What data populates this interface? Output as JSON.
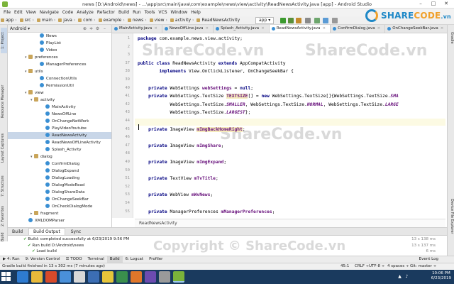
{
  "window": {
    "title": "news [D:\\Android\\news] - ...\\app\\src\\main\\java\\com\\example\\news\\view\\activity\\ReadNewsActivity.java [app] - Android Studio",
    "minimize": "–",
    "maximize": "□",
    "close": "✕"
  },
  "menu": [
    "File",
    "Edit",
    "View",
    "Navigate",
    "Code",
    "Analyze",
    "Refactor",
    "Build",
    "Run",
    "Tools",
    "VCS",
    "Window",
    "Help"
  ],
  "breadcrumb": [
    "app",
    "src",
    "main",
    "java",
    "com",
    "example",
    "news",
    "view",
    "activity",
    "ReadNewsActivity"
  ],
  "run_config": "app ▾",
  "logo": {
    "prefix": "SHARE",
    "suffix": "CODE",
    "domain": ".vn"
  },
  "watermark": "ShareCode.vn",
  "watermark_bottom": "Copyright © ShareCode.vn",
  "left_tabs": [
    "1: Project",
    "Resource Manager",
    "Layout Captures",
    "7: Structure",
    "2: Favorites",
    "Build Variants"
  ],
  "right_tabs": [
    "Gradle",
    "Device File Explorer"
  ],
  "project": {
    "selector": "Android ▾",
    "header_icons": [
      "⊕",
      "≑",
      "⚙",
      "–"
    ],
    "tree": [
      {
        "label": "News",
        "type": "cls",
        "depth": 5,
        "arrow": ""
      },
      {
        "label": "PlayList",
        "type": "cls",
        "depth": 5,
        "arrow": ""
      },
      {
        "label": "Video",
        "type": "cls",
        "depth": 5,
        "arrow": ""
      },
      {
        "label": "preferences",
        "type": "pkg",
        "depth": 3,
        "arrow": "▾"
      },
      {
        "label": "ManagerPreferences",
        "type": "cls",
        "depth": 5,
        "arrow": ""
      },
      {
        "label": "utils",
        "type": "pkg",
        "depth": 3,
        "arrow": "▾"
      },
      {
        "label": "ConnectionUtils",
        "type": "cls",
        "depth": 5,
        "arrow": ""
      },
      {
        "label": "PermissionUtil",
        "type": "cls",
        "depth": 5,
        "arrow": ""
      },
      {
        "label": "view",
        "type": "pkg",
        "depth": 3,
        "arrow": "▾"
      },
      {
        "label": "activity",
        "type": "pkg",
        "depth": 4,
        "arrow": "▾"
      },
      {
        "label": "MainActivity",
        "type": "cls",
        "depth": 6,
        "arrow": ""
      },
      {
        "label": "NewsOffLine",
        "type": "cls",
        "depth": 6,
        "arrow": ""
      },
      {
        "label": "OnChangeNetWork",
        "type": "cls",
        "depth": 6,
        "arrow": ""
      },
      {
        "label": "PlayVideoYoutube",
        "type": "cls",
        "depth": 6,
        "arrow": ""
      },
      {
        "label": "ReadNewsActivity",
        "type": "cls",
        "depth": 6,
        "arrow": "",
        "selected": true
      },
      {
        "label": "ReadNewsOffLineActivity",
        "type": "cls",
        "depth": 6,
        "arrow": ""
      },
      {
        "label": "Splash_Activity",
        "type": "cls",
        "depth": 6,
        "arrow": ""
      },
      {
        "label": "dialog",
        "type": "pkg",
        "depth": 4,
        "arrow": "▾"
      },
      {
        "label": "ConfirmDialog",
        "type": "cls",
        "depth": 6,
        "arrow": ""
      },
      {
        "label": "DialogExpand",
        "type": "cls",
        "depth": 6,
        "arrow": ""
      },
      {
        "label": "DialogLoading",
        "type": "cls",
        "depth": 6,
        "arrow": ""
      },
      {
        "label": "DialogModeRead",
        "type": "cls",
        "depth": 6,
        "arrow": ""
      },
      {
        "label": "DialogShareData",
        "type": "cls",
        "depth": 6,
        "arrow": ""
      },
      {
        "label": "OnChangeSeekBar",
        "type": "cls",
        "depth": 6,
        "arrow": ""
      },
      {
        "label": "OnCheckDialogMode",
        "type": "cls",
        "depth": 6,
        "arrow": ""
      },
      {
        "label": "fragment",
        "type": "pkg",
        "depth": 4,
        "arrow": "▸"
      },
      {
        "label": "XMLDOMParser",
        "type": "cls",
        "depth": 3,
        "arrow": ""
      }
    ]
  },
  "editor_tabs": [
    {
      "label": "MainActivity.java",
      "active": false
    },
    {
      "label": "NewsOffLine.java",
      "active": false
    },
    {
      "label": "Splash_Activity.java",
      "active": false
    },
    {
      "label": "ReadNewsActivity.java",
      "active": true
    },
    {
      "label": "ConfirmDialog.java",
      "active": false
    },
    {
      "label": "OnChangeSeekBar.java",
      "active": false
    }
  ],
  "code": [
    {
      "ln": "1",
      "html": "<span class=\"kw\">package</span> com.example.news.view.activity;"
    },
    {
      "ln": "2",
      "html": ""
    },
    {
      "ln": "3",
      "html": ""
    },
    {
      "ln": "37",
      "html": "<span class=\"kw\">public class</span> ReadNewsActivity <span class=\"kw\">extends</span> AppCompatActivity"
    },
    {
      "ln": "38",
      "html": "        <span class=\"kw\">implements</span> View.OnClickListener, OnChangeSeekBar {"
    },
    {
      "ln": "39",
      "html": ""
    },
    {
      "ln": "40",
      "html": "    <span class=\"kw\">private</span> WebSettings <span class=\"fld\">webSettings</span> = <span class=\"kw\">null</span>;"
    },
    {
      "ln": "41",
      "html": "    <span class=\"kw\">private</span> WebSettings.TextSize <span class=\"fld warnbg\">TEXTSIZE</span>[] = <span class=\"kw\">new</span> WebSettings.TextSize[]{WebSettings.TextSize.<span class=\"it\">SMA</span>"
    },
    {
      "ln": "42",
      "html": "            WebSettings.TextSize.<span class=\"it\">SMALLER</span>, WebSettings.TextSize.<span class=\"it\">NORMAL</span>, WebSettings.TextSize.<span class=\"it\">LARGE</span>"
    },
    {
      "ln": "43",
      "html": "            WebSettings.TextSize.<span class=\"it\">LARGEST</span>};"
    },
    {
      "ln": "44",
      "html": "",
      "hl": true
    },
    {
      "ln": "45",
      "html": "    <span class=\"kw\">private</span> ImageView <span class=\"fld warnbg\">mImgBackHomeRight</span>;"
    },
    {
      "ln": "46",
      "html": ""
    },
    {
      "ln": "47",
      "html": "    <span class=\"kw\">private</span> ImageView <span class=\"fld\">mImgShare</span>;"
    },
    {
      "ln": "48",
      "html": ""
    },
    {
      "ln": "49",
      "html": "    <span class=\"kw\">private</span> ImageView <span class=\"fld\">mImgExpand</span>;"
    },
    {
      "ln": "50",
      "html": ""
    },
    {
      "ln": "51",
      "html": "    <span class=\"kw\">private</span> TextView <span class=\"fld\">mTvTitle</span>;"
    },
    {
      "ln": "52",
      "html": ""
    },
    {
      "ln": "53",
      "html": "    <span class=\"kw\">private</span> WebView <span class=\"fld\">mWvNews</span>;"
    },
    {
      "ln": "54",
      "html": ""
    },
    {
      "ln": "55",
      "html": "    <span class=\"kw\">private</span> ManagerPreferences <span class=\"fld\">mManagerPreferences</span>;"
    }
  ],
  "editor_breadcrumb": "ReadNewsActivity",
  "build": {
    "tabs": [
      "Build",
      "Build Output",
      "Sync"
    ],
    "rows": [
      {
        "text": "Build: completed successfully at 6/23/2019 9:56 PM",
        "time": "13 s 138 ms",
        "indent": 0
      },
      {
        "text": "Run build D:\\Android\\news",
        "time": "13 s 137 ms",
        "indent": 6
      },
      {
        "text": "Load build",
        "time": "6 ms",
        "indent": 12
      }
    ]
  },
  "tool_tabs": [
    "▶ 4: Run",
    "9: Version Control",
    "☰ TODO",
    "Terminal",
    "Build",
    "6: Logcat",
    "Profiler"
  ],
  "event_log": "Event Log",
  "status": {
    "message": "Gradle build finished in 13 s 302 ms (7 minutes ago)",
    "position": "45:1",
    "line_sep": "CRLF ÷",
    "encoding": "UTF-8 ÷",
    "indent": "4 spaces ÷",
    "vcs": "Git: master ÷"
  },
  "clock": {
    "time": "10:06 PM",
    "date": "6/23/2019"
  },
  "colors": {
    "accent": "#1e88c7",
    "logo_orange": "#f0a02b",
    "taskbar": "#1a3a5e"
  }
}
